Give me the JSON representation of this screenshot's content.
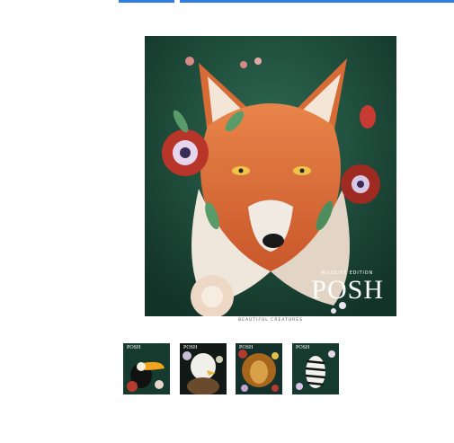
{
  "gallery": {
    "main": {
      "edition_label": "WILDLIFE EDITION",
      "title": "POSH",
      "subtitle": "BEAUTIFUL CREATURES"
    },
    "thumbnails": [
      {
        "brand": "POSH",
        "animal": "toucan"
      },
      {
        "brand": "POSH",
        "animal": "eagle"
      },
      {
        "brand": "POSH",
        "animal": "lion"
      },
      {
        "brand": "POSH",
        "animal": "zebra"
      }
    ]
  },
  "colors": {
    "accent": "#2f7de1",
    "cover_background": "#1f4a3b"
  }
}
